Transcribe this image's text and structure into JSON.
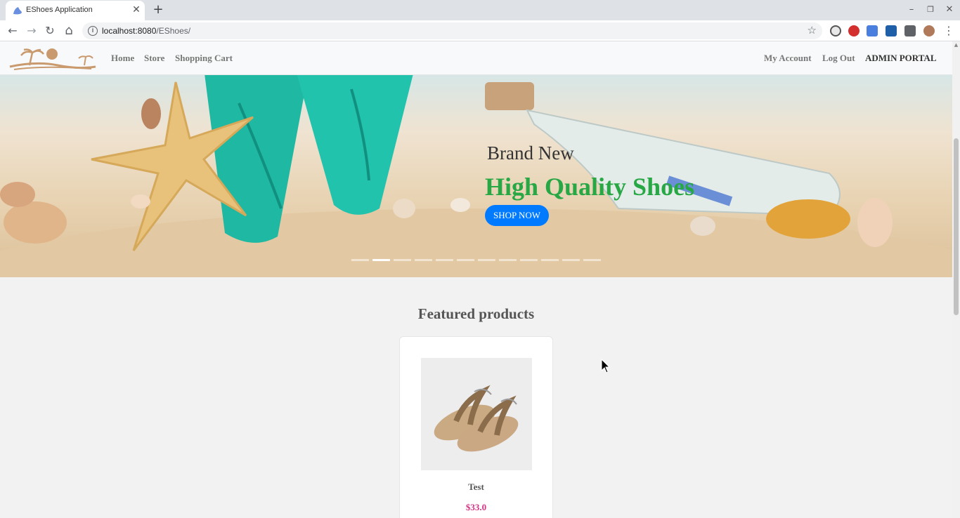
{
  "browser": {
    "tab_title": "EShoes Application",
    "tab_close": "✕",
    "new_tab": "+",
    "url_host": "localhost:8080",
    "url_path": "/EShoes/",
    "info_glyph": "i",
    "star_glyph": "☆",
    "back_glyph": "←",
    "forward_glyph": "→",
    "reload_glyph": "↻",
    "home_glyph": "⌂",
    "menu_glyph": "⋮",
    "minimize_glyph": "–",
    "restore_glyph": "❐",
    "close_glyph": "✕"
  },
  "navbar": {
    "links_left": [
      "Home",
      "Store",
      "Shopping Cart"
    ],
    "my_account": "My Account",
    "log_out": "Log Out",
    "admin_portal": "ADMIN PORTAL"
  },
  "hero": {
    "subtitle": "Brand New",
    "title": "High Quality Shoes",
    "button": "SHOP NOW",
    "slide_count": 12,
    "active_slide_index": 1
  },
  "featured": {
    "title": "Featured products",
    "products": [
      {
        "name": "Test",
        "price": "$33.0"
      }
    ]
  },
  "colors": {
    "accent_green": "#28a745",
    "button_blue": "#007bff",
    "price_pink": "#d63384",
    "logo_tan": "#c99a6e"
  }
}
